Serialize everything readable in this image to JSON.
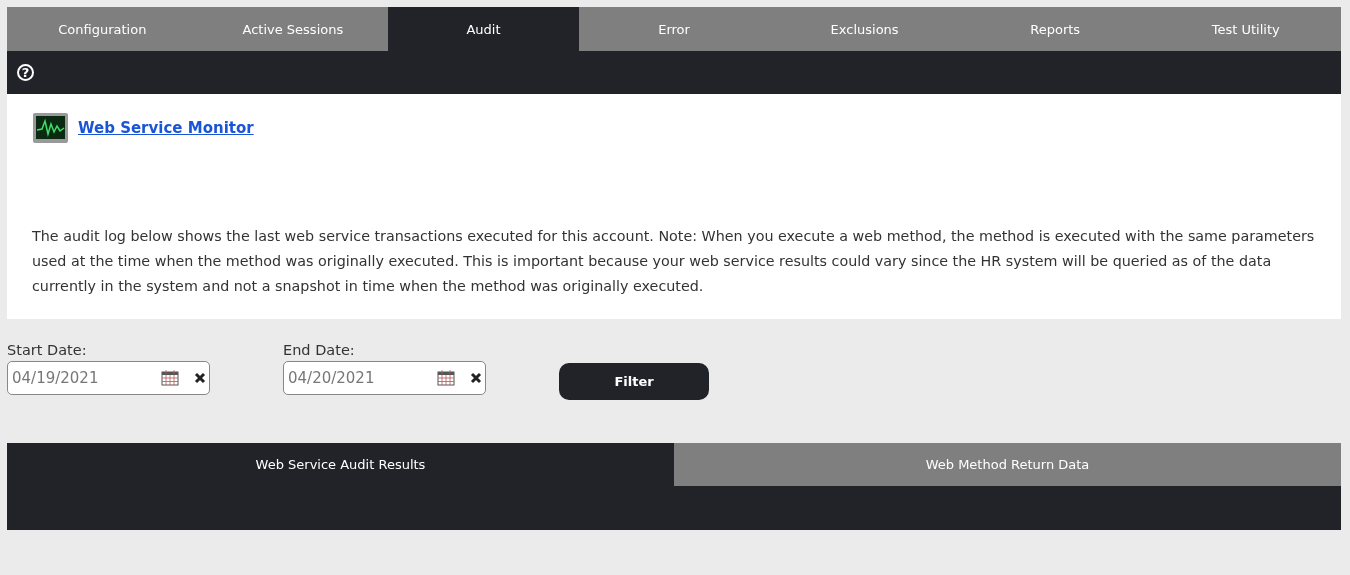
{
  "tabs": [
    {
      "label": "Configuration",
      "selected": false
    },
    {
      "label": "Active Sessions",
      "selected": false
    },
    {
      "label": "Audit",
      "selected": true
    },
    {
      "label": "Error",
      "selected": false
    },
    {
      "label": "Exclusions",
      "selected": false
    },
    {
      "label": "Reports",
      "selected": false
    },
    {
      "label": "Test Utility",
      "selected": false
    }
  ],
  "help_label": "?",
  "monitor_link": "Web Service Monitor",
  "description": "The audit log below shows the last web service transactions executed for this account. Note: When you execute a web method, the method is executed with the same parameters used at the time when the method was originally executed. This is important because your web service results could vary since the HR system will be queried as of the data currently in the system and not a snapshot in time when the method was originally executed.",
  "filters": [
    {
      "label": "Start Date:",
      "value": "04/19/2021"
    },
    {
      "label": "End Date:",
      "value": "04/20/2021"
    }
  ],
  "filter_button": "Filter",
  "result_tabs": [
    {
      "label": "Web Service Audit Results",
      "selected": true
    },
    {
      "label": "Web Method Return Data",
      "selected": false
    }
  ]
}
